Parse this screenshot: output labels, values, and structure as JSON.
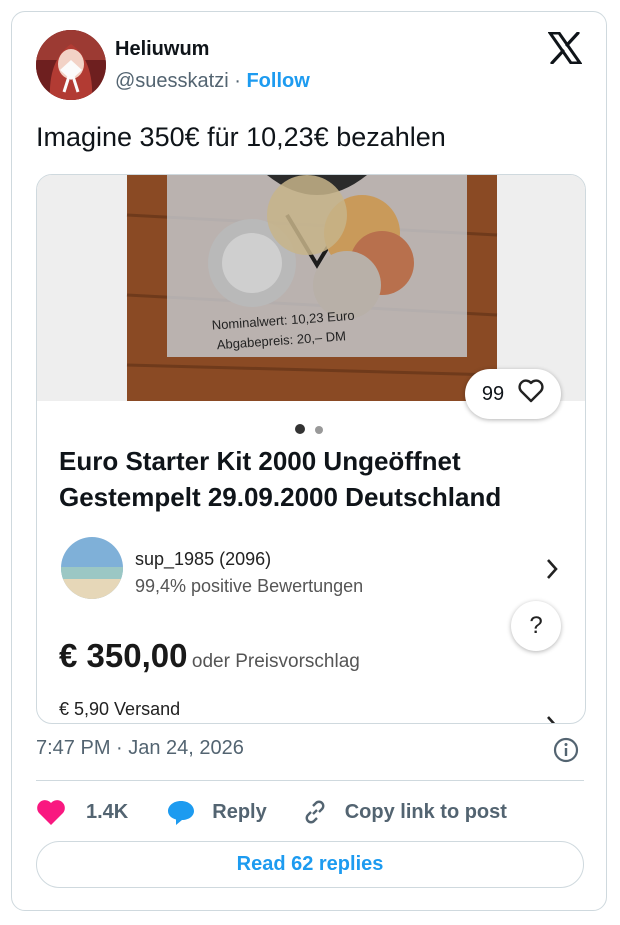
{
  "tweet": {
    "display_name": "Heliuwum",
    "handle": "@suesskatzi",
    "separator": "·",
    "follow_label": "Follow",
    "text": "Imagine 350€ für 10,23€ bezahlen",
    "timestamp": "7:47 PM · Jan 24, 2026",
    "likes_count": "1.4K",
    "reply_label": "Reply",
    "copy_link_label": "Copy link to post",
    "read_replies_label": "Read 62 replies"
  },
  "listing": {
    "photo_label_line1": "Nominalwert: 10,23 Euro",
    "photo_label_line2": "Abgabepreis: 20,– DM",
    "watchers": "99",
    "title": "Euro Starter Kit 2000 Ungeöffnet Gestempelt 29.09.2000 Deutschland",
    "seller_name": "sup_1985 (2096)",
    "seller_rating": "99,4% positive Bewertungen",
    "help_symbol": "?",
    "price": "€ 350,00",
    "price_note": "oder Preisvorschlag",
    "shipping": "€ 5,90 Versand",
    "image_pager": {
      "current": 1,
      "total": 2
    }
  },
  "colors": {
    "accent": "#1d9bf0",
    "like": "#f91880",
    "reply_icon": "#1d9bf0",
    "text_secondary": "#536471",
    "border": "#cfd9de"
  },
  "icons": [
    "x-logo-icon",
    "heart-outline-icon",
    "chevron-right-icon",
    "help-icon",
    "info-icon",
    "heart-filled-icon",
    "reply-bubble-icon",
    "link-icon"
  ]
}
